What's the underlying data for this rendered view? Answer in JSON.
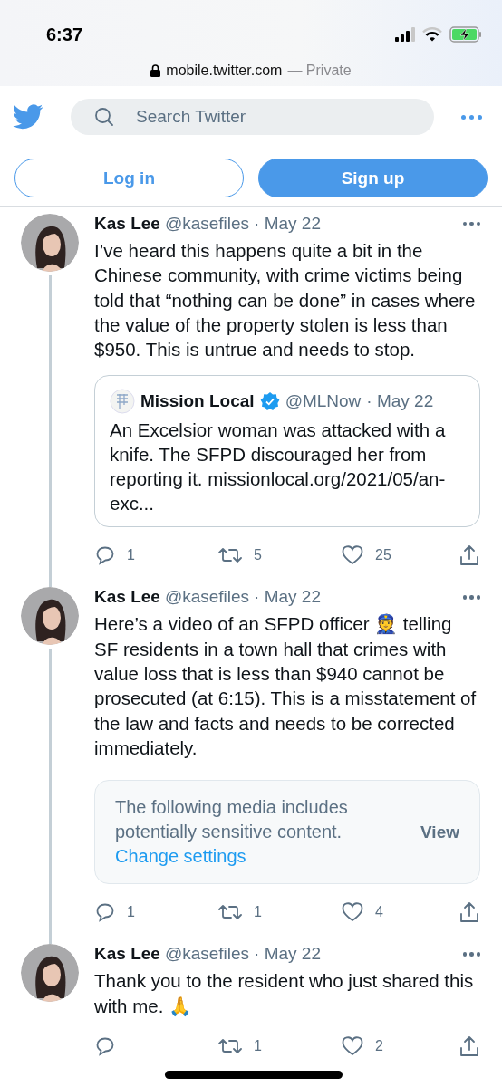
{
  "status_bar": {
    "time": "6:37"
  },
  "address_bar": {
    "domain": "mobile.twitter.com",
    "suffix": "— Private"
  },
  "header": {
    "search": {
      "placeholder": "Search Twitter"
    }
  },
  "auth_buttons": [
    {
      "label": "Log in",
      "kind": "outline"
    },
    {
      "label": "Sign up",
      "kind": "filled"
    }
  ],
  "tweets": [
    {
      "name": "Kas Lee",
      "handle": "@kasefiles",
      "date": "· May 22",
      "text": "I’ve heard this happens quite a bit in the Chinese community, with crime victims being told that “nothing can be done” in cases where the value of the property stolen is less than $950. This is untrue and needs to stop.",
      "attachment": {
        "kind": "quote",
        "name": "Mission Local",
        "verified": true,
        "handle": "@MLNow",
        "date": "· May 22",
        "text": "An Excelsior woman was attacked with a knife. The SFPD discouraged her from reporting it. missionlocal.org/2021/05/an-exc..."
      },
      "replies": "1",
      "retweets": "5",
      "likes": "25"
    },
    {
      "name": "Kas Lee",
      "handle": "@kasefiles",
      "date": "· May 22",
      "text": "Here’s a video of an SFPD officer 👮 telling SF residents in a town hall that crimes with value loss that is less than $940 cannot be prosecuted (at 6:15). This is a misstatement of the law and facts and needs to be corrected immediately.",
      "attachment": {
        "kind": "sensitive",
        "notice": "The following media includes potentially sensitive content.",
        "link": "Change settings",
        "action": "View"
      },
      "replies": "1",
      "retweets": "1",
      "likes": "4"
    },
    {
      "name": "Kas Lee",
      "handle": "@kasefiles",
      "date": "· May 22",
      "text": "Thank you to the resident who just shared this with me. 🙏",
      "retweets": "1",
      "likes": "2"
    }
  ]
}
